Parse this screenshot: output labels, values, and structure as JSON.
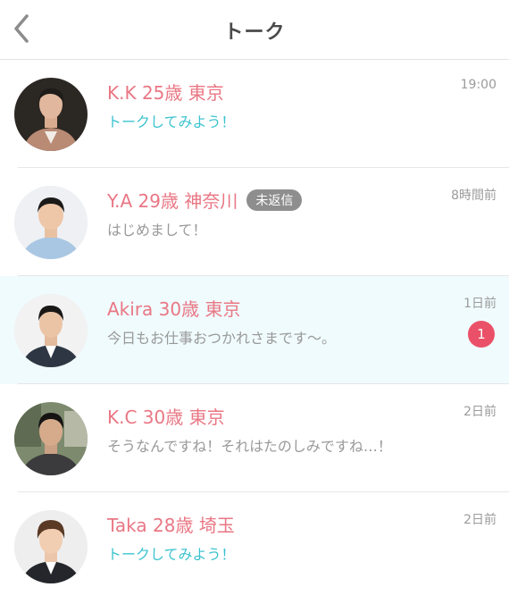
{
  "header": {
    "title": "トーク"
  },
  "colors": {
    "name": "#e97784",
    "prompt": "#3cc3cf",
    "badge_unread": "#ea5168",
    "badge_unreplied": "#8e8e8e",
    "highlight_bg": "#f0fbfd"
  },
  "conversations": [
    {
      "name": "K.K 25歳 東京",
      "message": "トークしてみよう！",
      "time": "19:00"
    },
    {
      "name": "Y.A 29歳 神奈川",
      "badge": "未返信",
      "message": "はじめまして！",
      "time": "8時間前"
    },
    {
      "name": "Akira 30歳 東京",
      "message": "今日もお仕事おつかれさまです〜。",
      "time": "1日前",
      "unread": "1"
    },
    {
      "name": "K.C 30歳 東京",
      "message": "そうなんですね！それはたのしみですね…！",
      "time": "2日前"
    },
    {
      "name": "Taka 28歳 埼玉",
      "message": "トークしてみよう！",
      "time": "2日前"
    }
  ]
}
